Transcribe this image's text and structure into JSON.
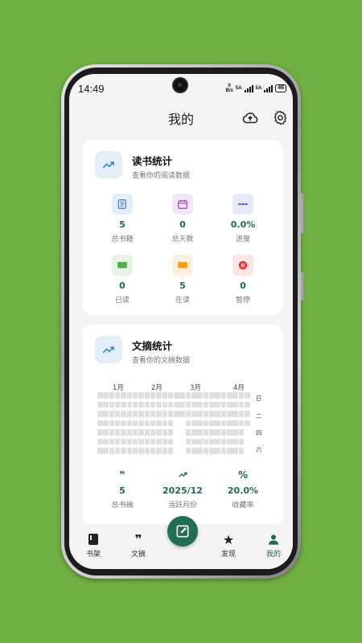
{
  "status_bar": {
    "time": "14:49",
    "net_speed": "0",
    "net_unit": "B/s",
    "sim1": "5A",
    "sim2": "5A",
    "battery": "46"
  },
  "appbar": {
    "title": "我的",
    "upload_icon": "cloud-upload-icon",
    "settings_icon": "gear-icon"
  },
  "reading_stats": {
    "title": "读书统计",
    "subtitle": "查看你的阅读数据",
    "icon": "trending-up-icon",
    "items": [
      {
        "value": "5",
        "label": "总书籍",
        "icon": "library-icon",
        "color": "#3b7bd8",
        "bg": "#e3eefb"
      },
      {
        "value": "0",
        "label": "总天数",
        "icon": "calendar-icon",
        "color": "#a23bc4",
        "bg": "#f3e6f8"
      },
      {
        "value": "0.0%",
        "label": "进度",
        "icon": "progress-dots-icon",
        "color": "#3f51b5",
        "bg": "#e7e9f6"
      },
      {
        "value": "0",
        "label": "已读",
        "icon": "book-read-icon",
        "color": "#4caf50",
        "bg": "#e6f4e7"
      },
      {
        "value": "5",
        "label": "在读",
        "icon": "book-open-icon",
        "color": "#f59c1a",
        "bg": "#fdf1dd"
      },
      {
        "value": "0",
        "label": "暂停",
        "icon": "pause-icon",
        "color": "#e53935",
        "bg": "#fbe5e5"
      }
    ]
  },
  "excerpt_stats": {
    "title": "文摘统计",
    "subtitle": "查看你的文摘数据",
    "icon": "trending-up-icon",
    "months": [
      "1月",
      "2月",
      "3月",
      "4月"
    ],
    "weekday_labels": [
      "日",
      "二",
      "四",
      "六"
    ],
    "heatmap_empty_weeks": [
      14
    ],
    "items": [
      {
        "value": "5",
        "label": "总书摘",
        "icon": "quote-icon"
      },
      {
        "value": "2025/12",
        "label": "活跃月份",
        "icon": "trending-up-icon"
      },
      {
        "value": "20.0%",
        "label": "收藏率",
        "icon": "percent-icon"
      }
    ]
  },
  "bottom_nav": {
    "items": [
      {
        "label": "书架",
        "icon": "book-icon"
      },
      {
        "label": "文摘",
        "icon": "quote-icon"
      },
      {
        "label": "发现",
        "icon": "sparkle-star-icon"
      },
      {
        "label": "我的",
        "icon": "person-icon"
      }
    ],
    "fab_icon": "edit-note-icon",
    "colors": {
      "active": "#1f6a4f",
      "fab": "#216e55"
    }
  }
}
